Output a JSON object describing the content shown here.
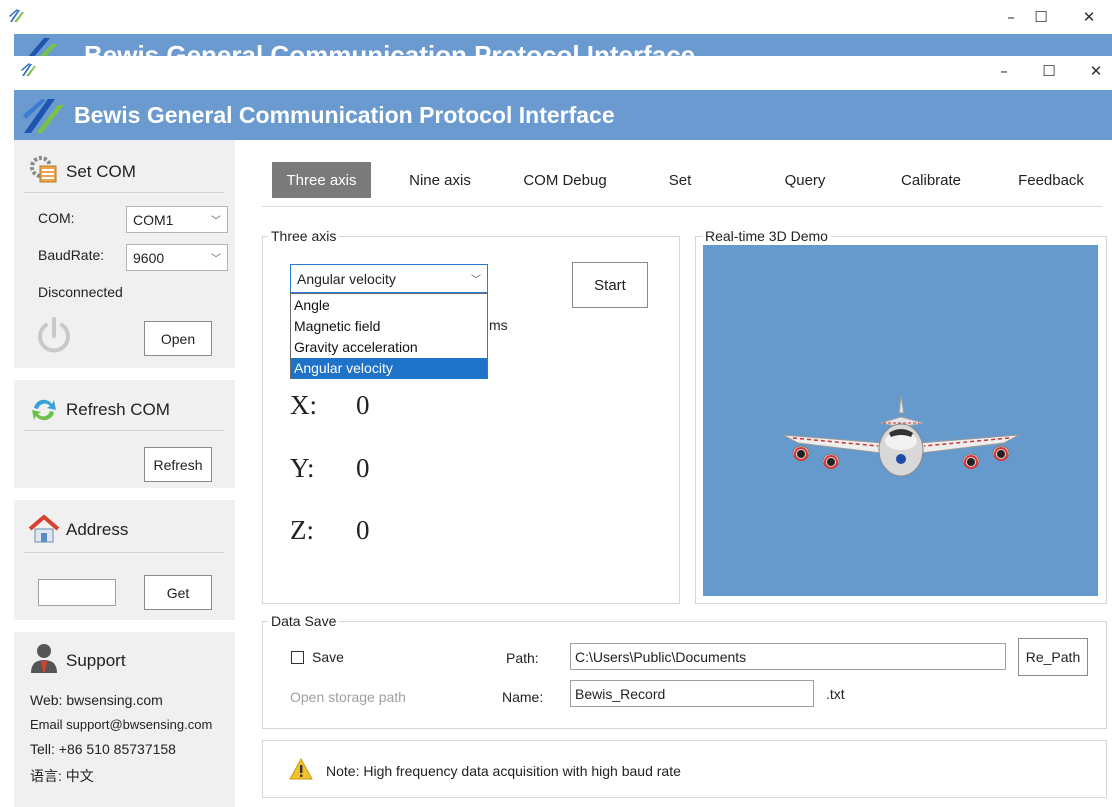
{
  "background_window": {
    "header_title": "Bewis General Communication Protocol Interface"
  },
  "window": {
    "header_title": "Bewis General Communication Protocol Interface",
    "controls": {
      "minimize": "–",
      "maximize": "☐",
      "close": "✕"
    }
  },
  "sidebar": {
    "set_com": {
      "title": "Set COM",
      "com_label": "COM:",
      "com_value": "COM1",
      "baud_label": "BaudRate:",
      "baud_value": "9600",
      "status": "Disconnected",
      "open_button": "Open"
    },
    "refresh": {
      "title": "Refresh COM",
      "button": "Refresh"
    },
    "address": {
      "title": "Address",
      "input_value": "",
      "button": "Get"
    },
    "support": {
      "title": "Support",
      "web": "Web: bwsensing.com",
      "email": "Email support@bwsensing.com",
      "tel": "Tell:  +86 510 85737158",
      "language": "语言:  中文"
    }
  },
  "tabs": [
    {
      "label": "Three axis",
      "active": true
    },
    {
      "label": "Nine axis"
    },
    {
      "label": "COM Debug"
    },
    {
      "label": "Set"
    },
    {
      "label": "Query"
    },
    {
      "label": "Calibrate"
    },
    {
      "label": "Feedback"
    }
  ],
  "three_axis": {
    "group_title": "Three axis",
    "selected": "Angular velocity",
    "options": [
      "Angle",
      "Magnetic field",
      "Gravity acceleration",
      "Angular velocity"
    ],
    "hidden_text_fragment": "ms",
    "start_button": "Start",
    "x_label": "X:",
    "x_value": "0",
    "y_label": "Y:",
    "y_value": "0",
    "z_label": "Z:",
    "z_value": "0"
  },
  "demo": {
    "group_title": "Real-time 3D Demo",
    "background": "#6699cc"
  },
  "data_save": {
    "group_title": "Data Save",
    "save_label": "Save",
    "save_checked": false,
    "path_label": "Path:",
    "path_value": "C:\\Users\\Public\\Documents",
    "repath_button": "Re_Path",
    "open_storage": "Open storage path",
    "name_label": "Name:",
    "name_value": "Bewis_Record",
    "ext": ".txt"
  },
  "note": {
    "text": "Note: High frequency data acquisition with high baud rate"
  },
  "colors": {
    "header": "#6b9ad1",
    "accent": "#1e73c8",
    "panel": "#f0f0f0"
  }
}
